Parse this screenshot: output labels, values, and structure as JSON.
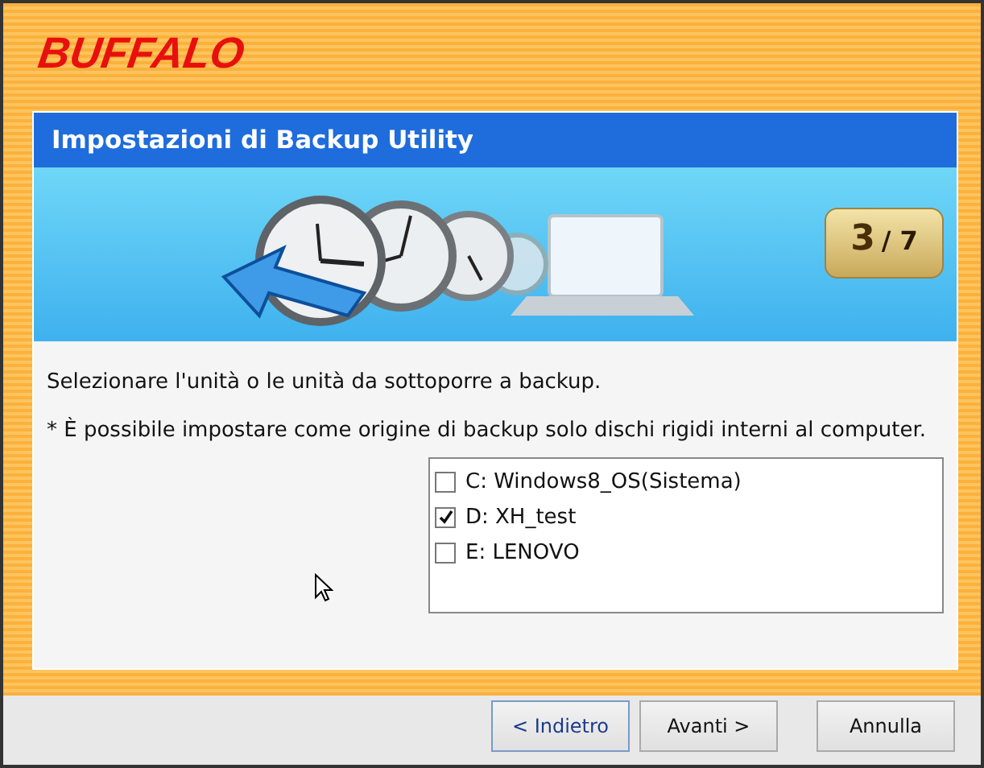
{
  "logo": "BUFFALO",
  "header": {
    "title": "Impostazioni di Backup Utility"
  },
  "step_badge": {
    "current": "3",
    "rest": "/ 7"
  },
  "instruction": "Selezionare l'unità o le unità da sottoporre a backup.",
  "note": "* È possibile impostare come origine di backup solo dischi rigidi interni al computer.",
  "drives": [
    {
      "label": "C: Windows8_OS(Sistema)",
      "checked": false
    },
    {
      "label": "D: XH_test",
      "checked": true
    },
    {
      "label": "E: LENOVO",
      "checked": false
    }
  ],
  "buttons": [
    {
      "label": "< Indietro",
      "focused": true
    },
    {
      "label": "Avanti >",
      "focused": false
    },
    {
      "label": "Annulla",
      "focused": false
    }
  ]
}
